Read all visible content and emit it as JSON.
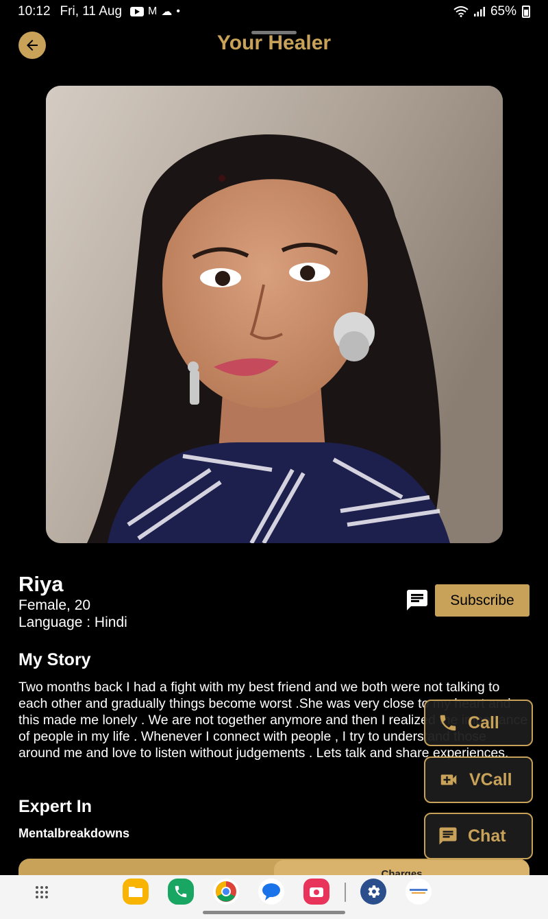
{
  "status_bar": {
    "time": "10:12",
    "date": "Fri, 11 Aug",
    "battery": "65%"
  },
  "header": {
    "title": "Your Healer"
  },
  "profile": {
    "name": "Riya",
    "gender_age": "Female, 20",
    "language": "Language : Hindi",
    "subscribe_label": "Subscribe"
  },
  "story": {
    "title": "My Story",
    "text": "Two months back I had a fight with my best friend and we both were not talking to each other and gradually things become worst .She was very close to my heart and this made me lonely . We are not together anymore and then I realized the importance of people in my life . Whenever I connect with people , I try to understand those around me and love to listen without judgements . Lets talk and share experiences."
  },
  "expertise": {
    "title": "Expert In",
    "items": [
      "Mentalbreakdowns"
    ]
  },
  "charges": {
    "label": "Charges"
  },
  "actions": {
    "call": "Call",
    "vcall": "VCall",
    "chat": "Chat"
  },
  "theme": {
    "accent": "#c9a25a",
    "background": "#000000"
  },
  "dock": {
    "apps": [
      "files-app",
      "phone-app",
      "chrome-app",
      "messages-app",
      "camera-app",
      "settings-app",
      "healer-app"
    ]
  }
}
